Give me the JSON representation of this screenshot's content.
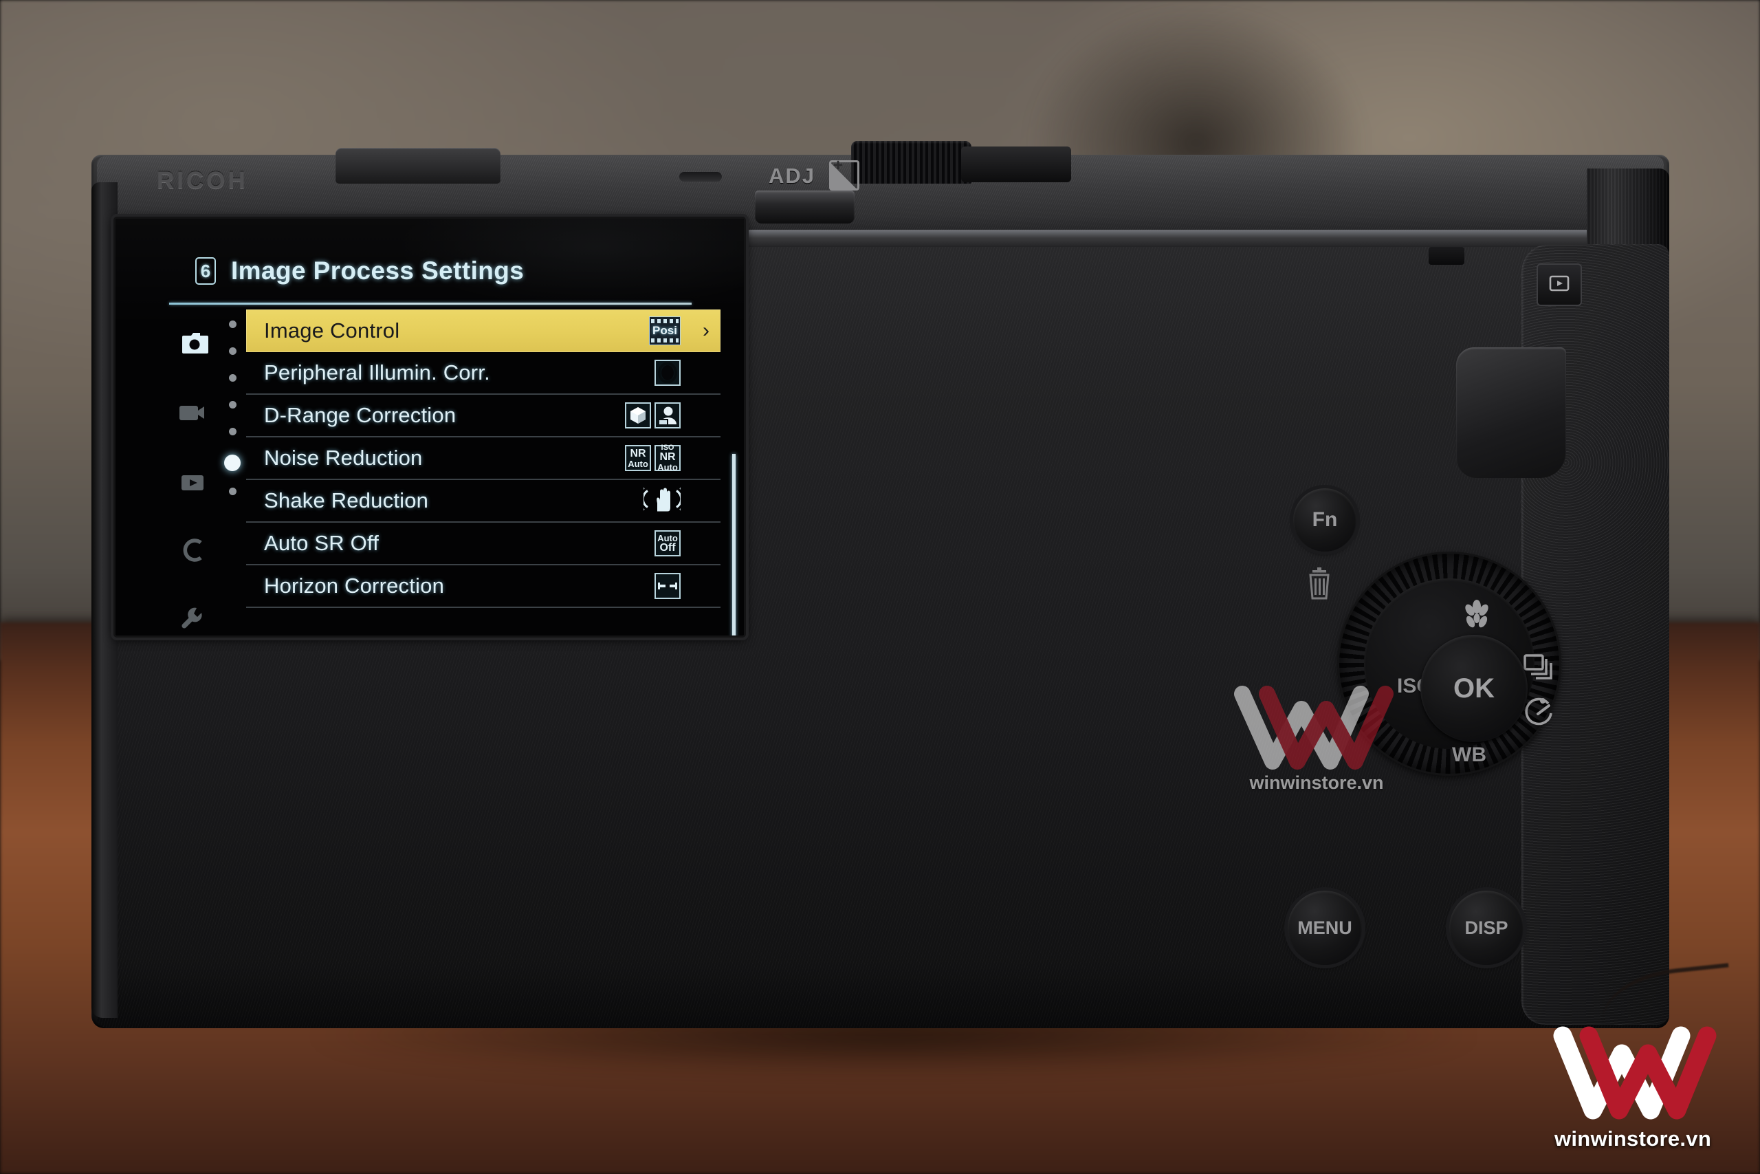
{
  "device": {
    "brand": "RICOH",
    "top_labels": {
      "adj": "ADJ"
    },
    "buttons": {
      "fn": "Fn",
      "menu": "MENU",
      "disp": "DISP",
      "ok": "OK",
      "iso": "ISO",
      "wb": "WB"
    },
    "icon_names": {
      "exposure_compensation": "exposure-compensation-icon",
      "playback": "playback-icon",
      "trash": "trash-icon",
      "macro": "macro-flower-icon",
      "drive": "drive-mode-icon",
      "self_timer": "self-timer-icon"
    }
  },
  "screen": {
    "page_number": "6",
    "title": "Image Process Settings",
    "highlight_color": "#e6cf5c",
    "text_color": "#dff0f6",
    "sidebar": [
      {
        "name": "still-capture-tab",
        "icon": "camera-icon",
        "active": true
      },
      {
        "name": "movie-tab",
        "icon": "video-camera-icon",
        "active": false
      },
      {
        "name": "playback-tab",
        "icon": "playback-icon",
        "active": false
      },
      {
        "name": "custom-tab",
        "icon": "custom-c-icon",
        "active": false
      },
      {
        "name": "setup-tab",
        "icon": "wrench-icon",
        "active": false
      }
    ],
    "page_dots": {
      "total": 7,
      "current": 6
    },
    "menu_items": [
      {
        "label": "Image Control",
        "value_type": "posi-badge",
        "value_text": "Posi",
        "selected": true,
        "has_chevron": true,
        "chevron": "›"
      },
      {
        "label": "Peripheral Illumin. Corr.",
        "value_type": "vignette-icon",
        "value_text": "",
        "selected": false,
        "has_chevron": false
      },
      {
        "label": "D-Range Correction",
        "value_type": "dual-icon-cube-portrait",
        "value_text": "",
        "selected": false,
        "has_chevron": false
      },
      {
        "label": "Noise Reduction",
        "value_type": "dual-badge",
        "badge_1": {
          "line1": "NR",
          "line2": "Auto"
        },
        "badge_2": {
          "line0": "ISO",
          "line1": "NR",
          "line2": "Auto"
        },
        "selected": false,
        "has_chevron": false
      },
      {
        "label": "Shake Reduction",
        "value_type": "shake-hand-icon",
        "value_text": "",
        "selected": false,
        "has_chevron": false
      },
      {
        "label": "Auto SR Off",
        "value_type": "badge",
        "badge_1": {
          "line1": "Auto",
          "line2": "Off"
        },
        "selected": false,
        "has_chevron": false
      },
      {
        "label": "Horizon Correction",
        "value_type": "horizon-level-icon",
        "value_text": "",
        "selected": false,
        "has_chevron": false
      }
    ]
  },
  "watermark": {
    "text": "winwinstore.vn",
    "brand_red": "#b51a2b",
    "brand_white": "#ffffff"
  }
}
